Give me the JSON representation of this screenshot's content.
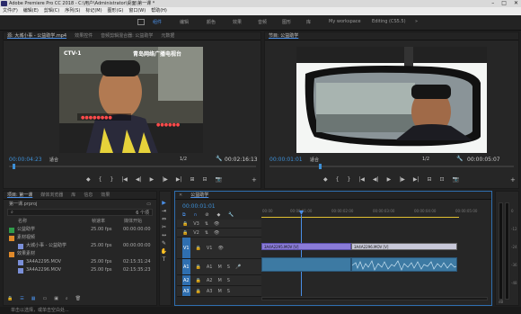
{
  "titlebar": {
    "title": "Adobe Premiere Pro CC 2018 - C:\\用户\\Administrator\\桌面\\第一课 *",
    "min": "–",
    "max": "□",
    "close": "✕"
  },
  "menu": [
    "文件(F)",
    "编辑(E)",
    "剪辑(C)",
    "序列(S)",
    "标记(M)",
    "图形(G)",
    "窗口(W)",
    "帮助(H)"
  ],
  "workspaces": [
    {
      "label": "组件",
      "active": true
    },
    {
      "label": "编辑",
      "active": false
    },
    {
      "label": "颜色",
      "active": false
    },
    {
      "label": "效果",
      "active": false
    },
    {
      "label": "音频",
      "active": false
    },
    {
      "label": "图形",
      "active": false
    },
    {
      "label": "库",
      "active": false
    },
    {
      "label": "My workspace",
      "active": false
    },
    {
      "label": "Editing (CS5.5)",
      "active": false
    }
  ],
  "source_monitor": {
    "tabs": [
      "源: 大城小事 - 公益助学.mp4",
      "效果控件",
      "音频剪辑混合器: 公益助学",
      "元数据"
    ],
    "overlay_logo": "CTV-1",
    "overlay_channel": "青岛网络广播电视台",
    "timecode_in": "00:00:04:23",
    "fit": "适合",
    "fraction": "1/2",
    "timecode_out": "00:02:16:13",
    "controls": [
      "◆",
      "{",
      "}",
      "|◀",
      "◀|",
      "▶",
      "|▶",
      "▶|",
      "⊞",
      "⊟",
      "📷"
    ]
  },
  "program_monitor": {
    "tab": "节目: 公益助学",
    "timecode_in": "00:00:01:01",
    "fit": "适合",
    "fraction": "1/2",
    "timecode_out": "00:00:05:07",
    "controls": [
      "◆",
      "{",
      "}",
      "|◀",
      "◀|",
      "▶",
      "|▶",
      "▶|",
      "⊟",
      "⊡",
      "📷"
    ]
  },
  "project": {
    "tabs": [
      "项目: 第一课",
      "媒体浏览器",
      "库",
      "信息",
      "效果"
    ],
    "name": "第一课.prproj",
    "count": "6 个项",
    "columns": [
      "名称",
      "帧速率",
      "媒体开始"
    ],
    "rows": [
      {
        "name": "公益助学",
        "fps": "25.00 fps",
        "start": "00:00:00:00",
        "color": "#2f9a4a",
        "indent": 0
      },
      {
        "name": "素材视频",
        "fps": "",
        "start": "",
        "color": "#e08a2a",
        "indent": 0
      },
      {
        "name": "大城小事 - 公益助学",
        "fps": "25.00 fps",
        "start": "00:00:00:00",
        "color": "#7a8fd8",
        "indent": 1
      },
      {
        "name": "效果素材",
        "fps": "",
        "start": "",
        "color": "#e08a2a",
        "indent": 0
      },
      {
        "name": "3A4A2295.MOV",
        "fps": "25.00 fps",
        "start": "02:15:31:24",
        "color": "#7a8fd8",
        "indent": 1
      },
      {
        "name": "3A4A2296.MOV",
        "fps": "25.00 fps",
        "start": "02:15:35:23",
        "color": "#7a8fd8",
        "indent": 1
      }
    ]
  },
  "tools": [
    "▶",
    "⇥",
    "⇔",
    "✂",
    "↔",
    "✎",
    "✋",
    "T"
  ],
  "timeline": {
    "tab": "公益助学",
    "timecode": "00:00:01:01",
    "ruler": [
      "00:00",
      "00:00:01:00",
      "00:00:02:00",
      "00:00:03:00",
      "00:00:04:00",
      "00:00:05:00"
    ],
    "tracks": [
      {
        "name": "V3",
        "type": "video"
      },
      {
        "name": "V2",
        "type": "video"
      },
      {
        "name": "V1",
        "type": "video"
      },
      {
        "name": "A1",
        "type": "audio"
      },
      {
        "name": "A2",
        "type": "audio"
      },
      {
        "name": "A3",
        "type": "audio"
      }
    ],
    "clip1_label": "3A4A2295.MOV [V]",
    "clip2_label": "3A4A2296.MOV [V]"
  },
  "meters": {
    "labels": [
      "0",
      "-12",
      "-24",
      "-36",
      "-48",
      "dB"
    ]
  },
  "status": "单击以选择，或单击空白处..."
}
